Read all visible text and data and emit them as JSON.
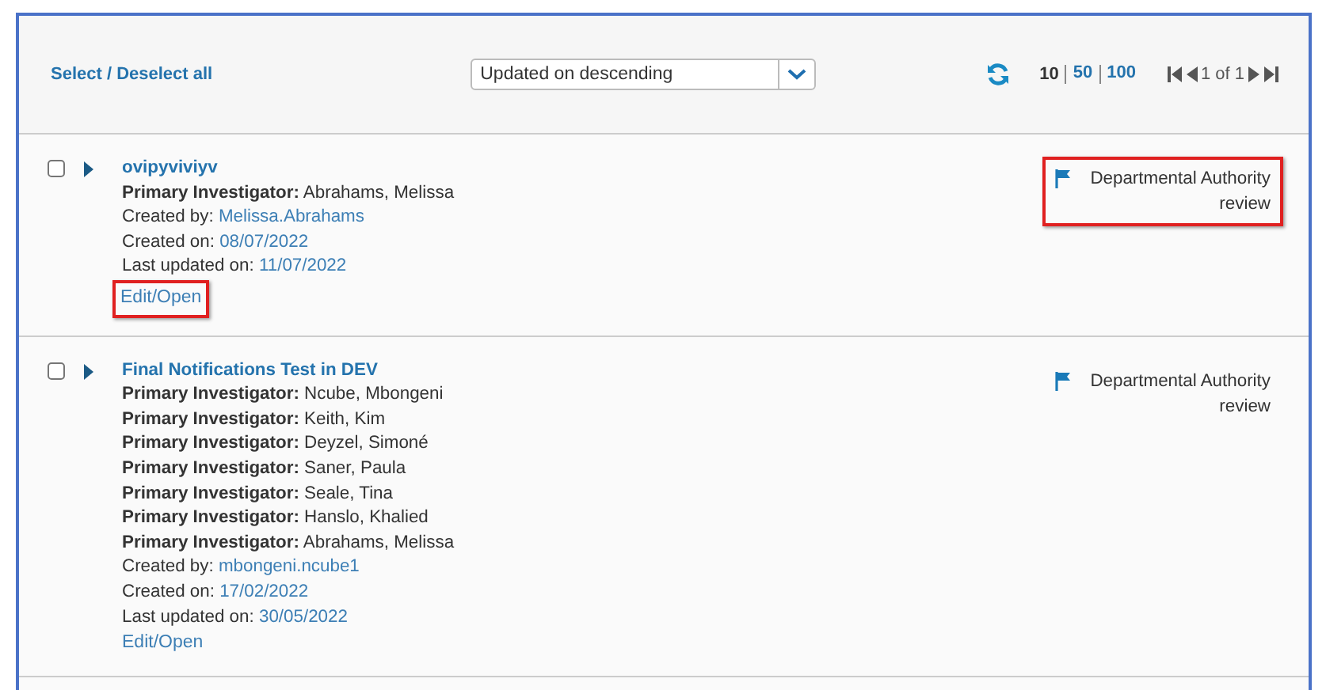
{
  "toolbar": {
    "select_all": "Select / Deselect all",
    "sort": {
      "value": "Updated on descending"
    },
    "page_sizes": [
      {
        "label": "10",
        "selected": true
      },
      {
        "label": "50",
        "selected": false
      },
      {
        "label": "100",
        "selected": false
      }
    ],
    "pager": "1 of 1"
  },
  "records": [
    {
      "title": "ovipyviviyv",
      "checked": false,
      "investigators": [
        {
          "label": "Primary Investigator:",
          "name": "Abrahams, Melissa"
        }
      ],
      "created_by_label": "Created by:",
      "created_by": "Melissa.Abrahams",
      "created_on_label": "Created on:",
      "created_on": "08/07/2022",
      "updated_label": "Last updated on:",
      "updated_on": "11/07/2022",
      "edit_link": "Edit/Open",
      "edit_highlighted": true,
      "status": "Departmental Authority review",
      "status_highlighted": true
    },
    {
      "title": "Final Notifications Test in DEV",
      "checked": false,
      "investigators": [
        {
          "label": "Primary Investigator:",
          "name": "Ncube, Mbongeni"
        },
        {
          "label": "Primary Investigator:",
          "name": "Keith, Kim"
        },
        {
          "label": "Primary Investigator:",
          "name": "Deyzel, Simoné"
        },
        {
          "label": "Primary Investigator:",
          "name": "Saner, Paula"
        },
        {
          "label": "Primary Investigator:",
          "name": "Seale, Tina"
        },
        {
          "label": "Primary Investigator:",
          "name": "Hanslo, Khalied"
        },
        {
          "label": "Primary Investigator:",
          "name": "Abrahams, Melissa"
        }
      ],
      "created_by_label": "Created by:",
      "created_by": "mbongeni.ncube1",
      "created_on_label": "Created on:",
      "created_on": "17/02/2022",
      "updated_label": "Last updated on:",
      "updated_on": "30/05/2022",
      "edit_link": "Edit/Open",
      "edit_highlighted": false,
      "status": "Departmental Authority review",
      "status_highlighted": false
    }
  ]
}
